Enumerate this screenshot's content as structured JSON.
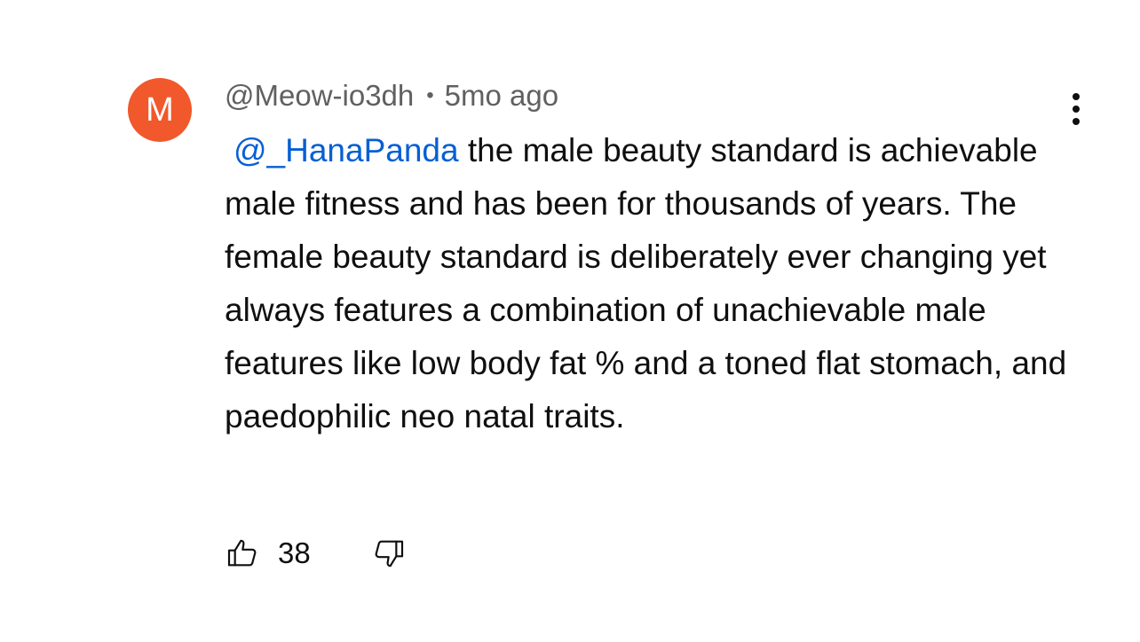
{
  "comment": {
    "avatar_letter": "M",
    "avatar_color": "#f1582b",
    "author": "@Meow-io3dh",
    "separator": "•",
    "timestamp": "5mo ago",
    "mention": "@_HanaPanda",
    "mention_color": "#065fd4",
    "body": " the male beauty standard is achievable male fitness and has been for thousands of years. The female beauty standard is deliberately ever changing yet always features a combination of unachievable male features like low body fat % and a toned flat stomach, and paedophilic neo natal traits.",
    "like_count": "38",
    "icons": {
      "like": "thumbs-up-icon",
      "dislike": "thumbs-down-icon",
      "more": "more-vertical-icon"
    }
  }
}
